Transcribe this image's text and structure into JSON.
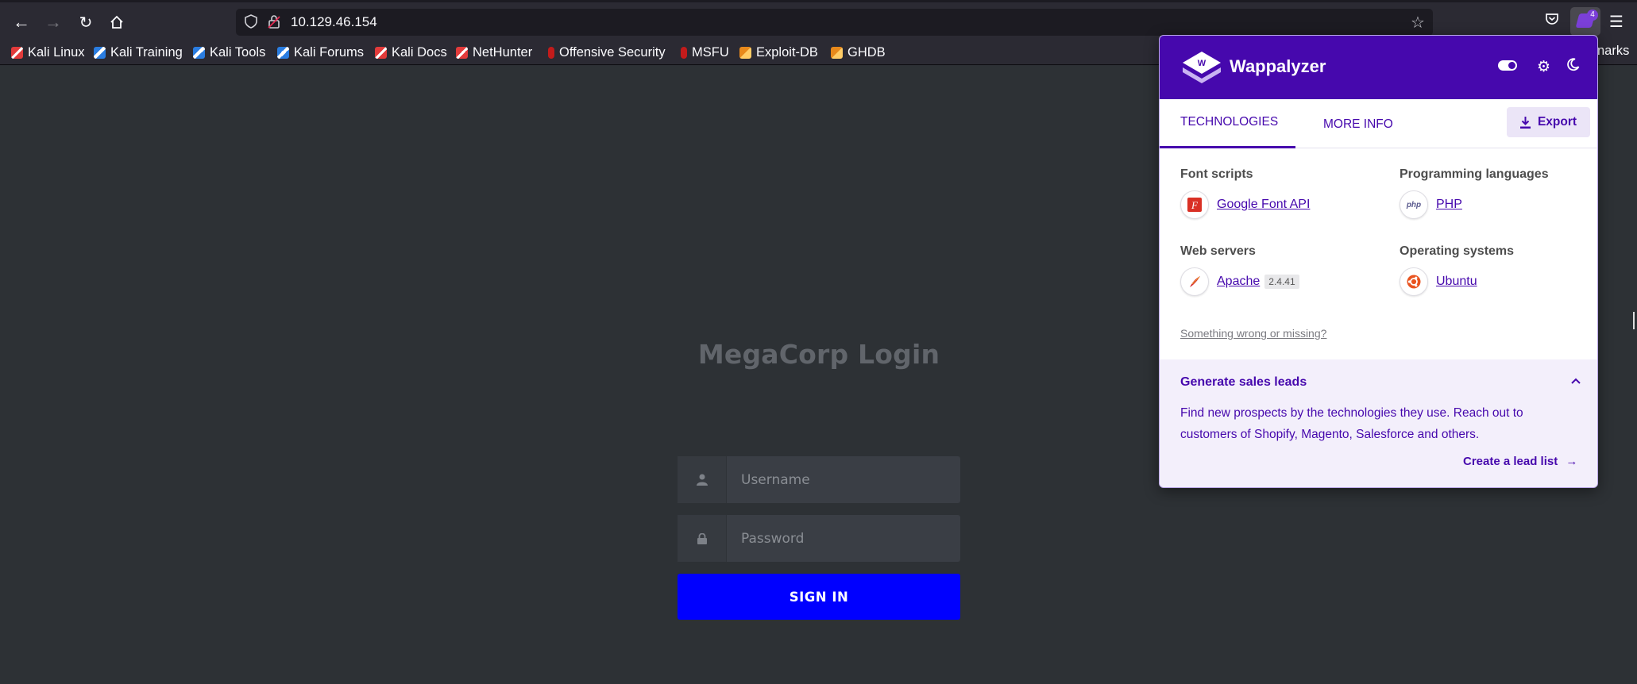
{
  "browser": {
    "url": "10.129.46.154",
    "bookmarks": [
      {
        "label": "Kali Linux",
        "icon": "kali"
      },
      {
        "label": "Kali Training",
        "icon": "kblue"
      },
      {
        "label": "Kali Tools",
        "icon": "kblue"
      },
      {
        "label": "Kali Forums",
        "icon": "kblue"
      },
      {
        "label": "Kali Docs",
        "icon": "kali"
      },
      {
        "label": "NetHunter",
        "icon": "kali"
      },
      {
        "label": "Offensive Security",
        "icon": "red"
      },
      {
        "label": "MSFU",
        "icon": "red"
      },
      {
        "label": "Exploit-DB",
        "icon": "orange"
      },
      {
        "label": "GHDB",
        "icon": "orange"
      }
    ],
    "bookmarks_overflow": "narks",
    "extension_badge": "4"
  },
  "login": {
    "title": "MegaCorp Login",
    "username_placeholder": "Username",
    "password_placeholder": "Password",
    "signin_label": "SIGN IN",
    "signin_color": "#0000ff"
  },
  "wappalyzer": {
    "title": "Wappalyzer",
    "brand_color": "#4608ad",
    "tabs": [
      "TECHNOLOGIES",
      "MORE INFO"
    ],
    "export_label": "Export",
    "categories": [
      {
        "name": "Font scripts",
        "techs": [
          {
            "name": "Google Font API",
            "icon": "google-font-icon"
          }
        ]
      },
      {
        "name": "Programming languages",
        "techs": [
          {
            "name": "PHP",
            "icon": "php-icon"
          }
        ]
      },
      {
        "name": "Web servers",
        "techs": [
          {
            "name": "Apache",
            "version": "2.4.41",
            "icon": "apache-feather-icon"
          }
        ]
      },
      {
        "name": "Operating systems",
        "techs": [
          {
            "name": "Ubuntu",
            "icon": "ubuntu-icon"
          }
        ]
      }
    ],
    "wrong_link": "Something wrong or missing?",
    "leads": {
      "title": "Generate sales leads",
      "text": "Find new prospects by the technologies they use. Reach out to customers of Shopify, Magento, Salesforce and others.",
      "cta": "Create a lead list"
    }
  }
}
